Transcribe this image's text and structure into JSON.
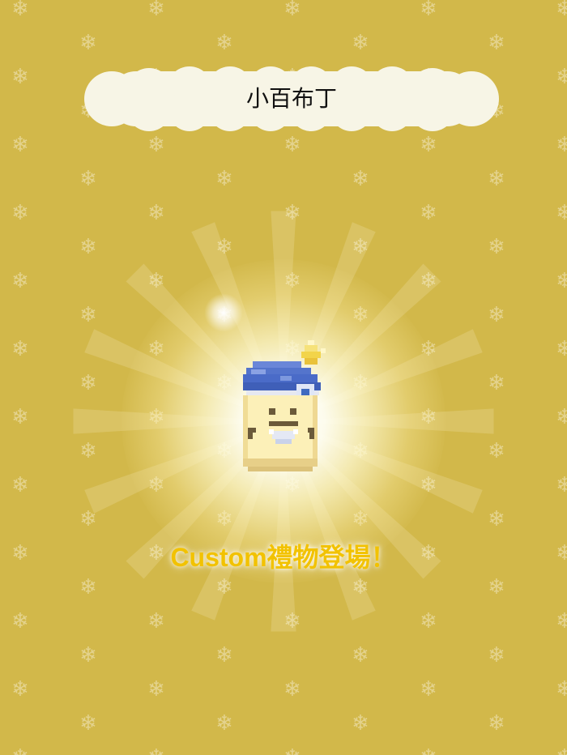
{
  "header": {
    "character_name": "小百布丁"
  },
  "main": {
    "banner_text": "Custom禮物登場！",
    "background_icon": "snowflake-icon",
    "sparkle_icon": "sparkle-icon"
  },
  "colors": {
    "background": "#d2b84a",
    "snowflake": "#e8d89a",
    "banner_text": "#f2c200",
    "cloud_fill": "#f7f5e6",
    "hat_blue": "#4a6bc8",
    "body_cream": "#fcf0b8"
  }
}
